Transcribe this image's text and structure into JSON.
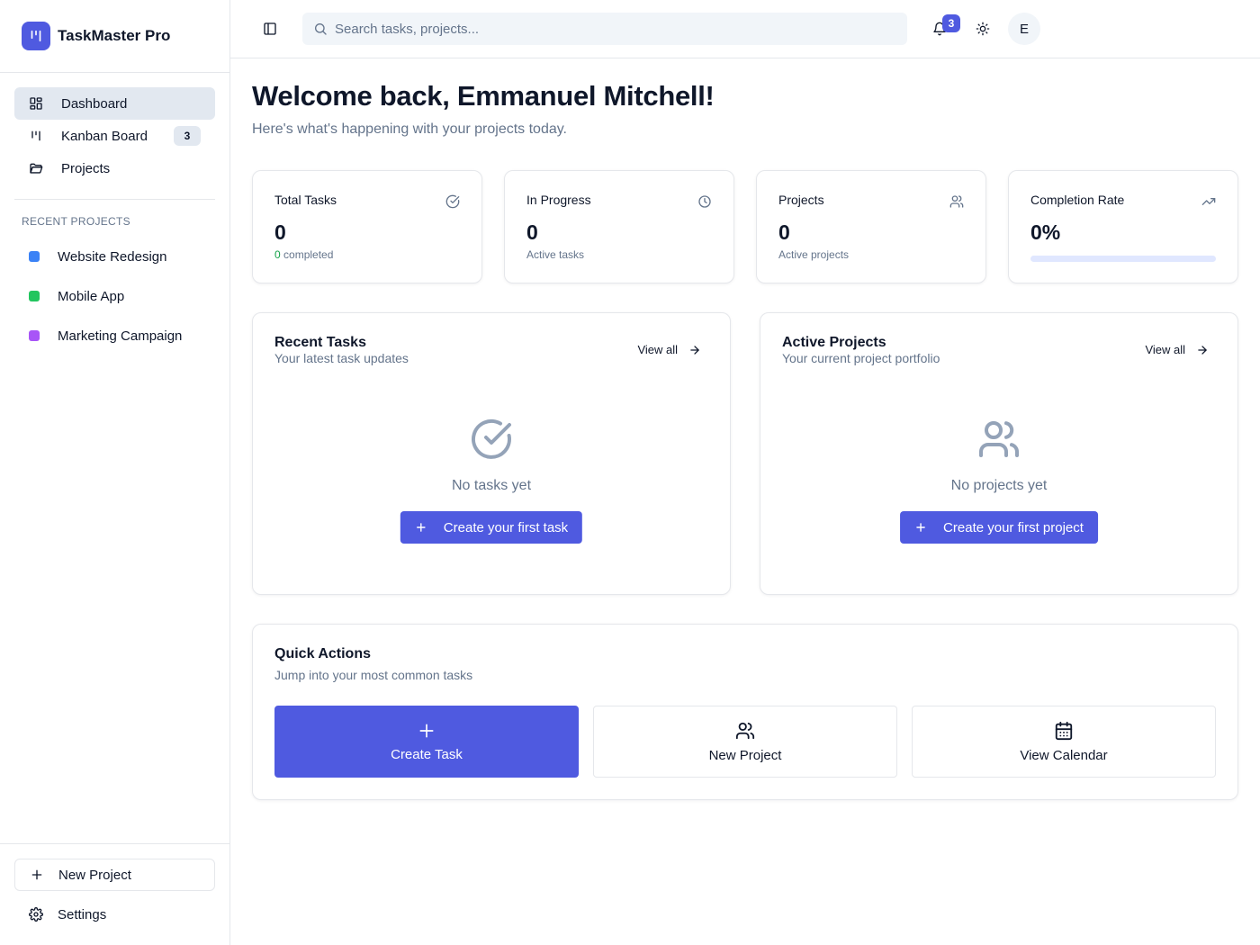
{
  "app": {
    "name": "TaskMaster Pro"
  },
  "sidebar": {
    "nav": [
      {
        "label": "Dashboard",
        "icon": "grid-icon",
        "active": true
      },
      {
        "label": "Kanban Board",
        "icon": "kanban-icon",
        "badge": "3"
      },
      {
        "label": "Projects",
        "icon": "folder-icon"
      }
    ],
    "recent_title": "RECENT PROJECTS",
    "recent_projects": [
      {
        "label": "Website Redesign",
        "color": "#3b82f6"
      },
      {
        "label": "Mobile App",
        "color": "#22c55e"
      },
      {
        "label": "Marketing Campaign",
        "color": "#a855f7"
      }
    ],
    "new_project_label": "New Project",
    "settings_label": "Settings"
  },
  "header": {
    "search_placeholder": "Search tasks, projects...",
    "notification_count": "3",
    "avatar_initial": "E"
  },
  "main": {
    "welcome": "Welcome back, Emmanuel Mitchell!",
    "subtitle": "Here's what's happening with your projects today.",
    "stats": {
      "total_tasks": {
        "title": "Total Tasks",
        "value": "0",
        "sub_count": "0",
        "sub_text": "completed"
      },
      "in_progress": {
        "title": "In Progress",
        "value": "0",
        "sub_text": "Active tasks"
      },
      "projects": {
        "title": "Projects",
        "value": "0",
        "sub_text": "Active projects"
      },
      "completion": {
        "title": "Completion Rate",
        "value": "0%",
        "progress": 0
      }
    },
    "recent_tasks": {
      "title": "Recent Tasks",
      "subtitle": "Your latest task updates",
      "view_all": "View all",
      "empty_text": "No tasks yet",
      "cta": "Create your first task"
    },
    "active_projects": {
      "title": "Active Projects",
      "subtitle": "Your current project portfolio",
      "view_all": "View all",
      "empty_text": "No projects yet",
      "cta": "Create your first project"
    },
    "quick_actions": {
      "title": "Quick Actions",
      "subtitle": "Jump into your most common tasks",
      "items": [
        {
          "label": "Create Task",
          "icon": "plus-icon"
        },
        {
          "label": "New Project",
          "icon": "users-icon"
        },
        {
          "label": "View Calendar",
          "icon": "calendar-icon"
        }
      ]
    }
  },
  "colors": {
    "accent": "#4f5ae0",
    "success": "#16a34a"
  }
}
